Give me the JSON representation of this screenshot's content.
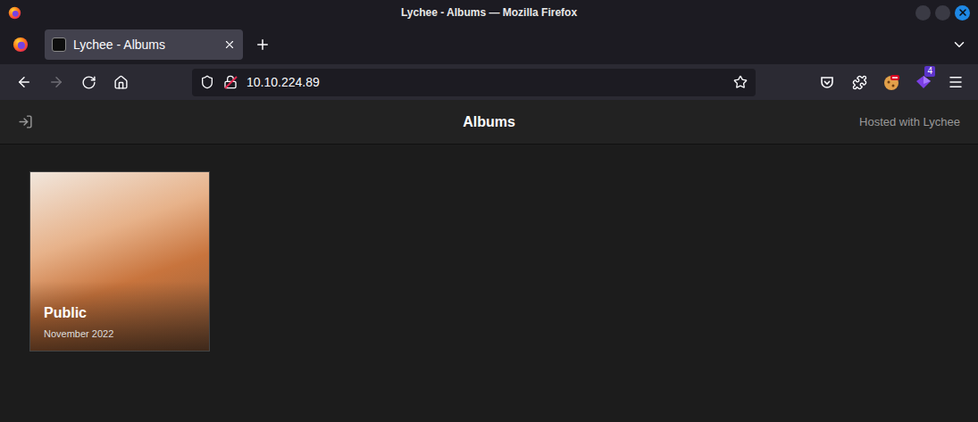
{
  "window": {
    "title": "Lychee - Albums — Mozilla Firefox"
  },
  "tabs": [
    {
      "label": "Lychee - Albums",
      "selected": true
    }
  ],
  "toolbar": {
    "back_disabled": false,
    "forward_disabled": true,
    "url": "10.10.224.89",
    "extension_badge": "4"
  },
  "page": {
    "header": {
      "title": "Albums",
      "hosted": "Hosted with Lychee"
    },
    "albums": [
      {
        "title": "Public",
        "date": "November 2022"
      }
    ]
  }
}
